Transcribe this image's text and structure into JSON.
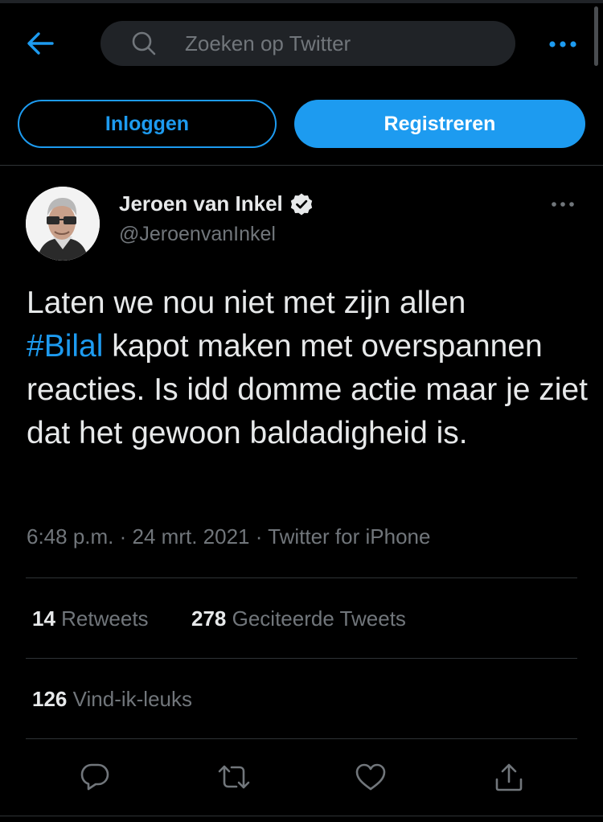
{
  "colors": {
    "accent": "#1d9bf0",
    "background": "#000000",
    "text_primary": "#e7e9ea",
    "text_secondary": "#71767b",
    "divider": "#2f3336",
    "search_bg": "#202327"
  },
  "header": {
    "back_icon": "arrow-left-icon",
    "search": {
      "placeholder": "Zoeken op Twitter",
      "value": "",
      "icon": "search-icon"
    },
    "more_icon": "more-horizontal-icon"
  },
  "auth": {
    "login_label": "Inloggen",
    "register_label": "Registreren"
  },
  "tweet": {
    "author": {
      "name": "Jeroen van Inkel",
      "handle": "@JeroenvanInkel",
      "verified_icon": "verified-badge-icon"
    },
    "text": {
      "part1": "Laten we nou niet met zijn allen",
      "hashtag": "#Bilal",
      "part2": " kapot maken met overspannen reacties. Is idd domme actie maar je ziet dat het gewoon baldadigheid is."
    },
    "meta": {
      "time": "6:48 p.m.",
      "separator": " · ",
      "date": "24 mrt. 2021",
      "source": "Twitter for iPhone"
    },
    "stats": {
      "retweets": {
        "count": "14",
        "label": "Retweets"
      },
      "quotes": {
        "count": "278",
        "label": "Geciteerde Tweets"
      },
      "likes": {
        "count": "126",
        "label": "Vind-ik-leuks"
      }
    },
    "actions": [
      "reply-icon",
      "retweet-icon",
      "like-icon",
      "share-icon"
    ]
  }
}
